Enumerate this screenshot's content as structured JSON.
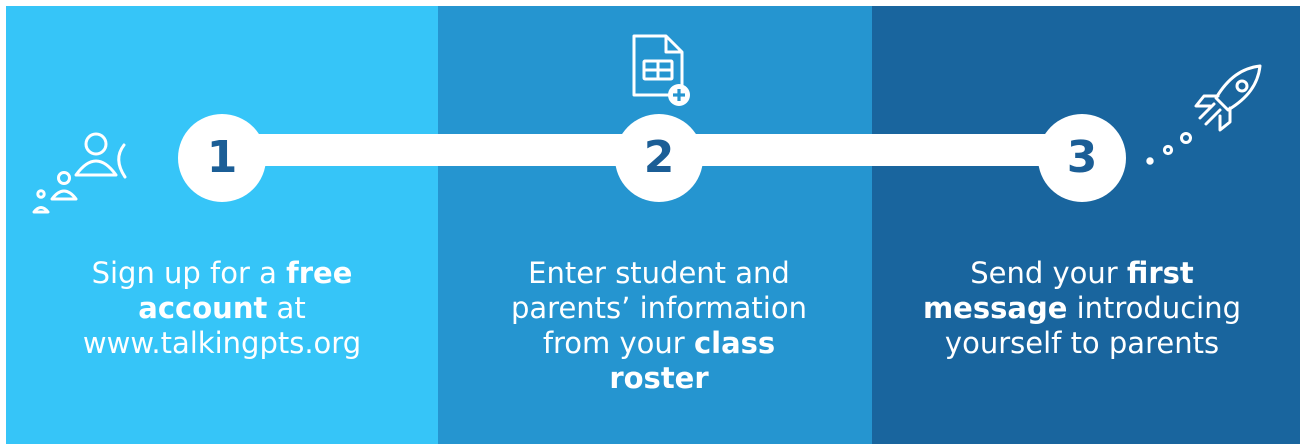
{
  "colors": {
    "step1": "#36c5f8",
    "step2": "#2595d0",
    "step3": "#19659e",
    "number": "#1b5e96",
    "white": "#ffffff"
  },
  "steps": [
    {
      "number": "1",
      "icon": "users-icon",
      "text_1": "Sign up for a ",
      "bold_1": "free account",
      "text_2": " at www.talkingpts.org"
    },
    {
      "number": "2",
      "icon": "spreadsheet-add-icon",
      "text_1": "Enter student and parents’ information from your ",
      "bold_1": "class roster",
      "text_2": ""
    },
    {
      "number": "3",
      "icon": "rocket-icon",
      "text_1": "Send your ",
      "bold_1": "first message",
      "text_2": " introducing yourself to parents"
    }
  ]
}
